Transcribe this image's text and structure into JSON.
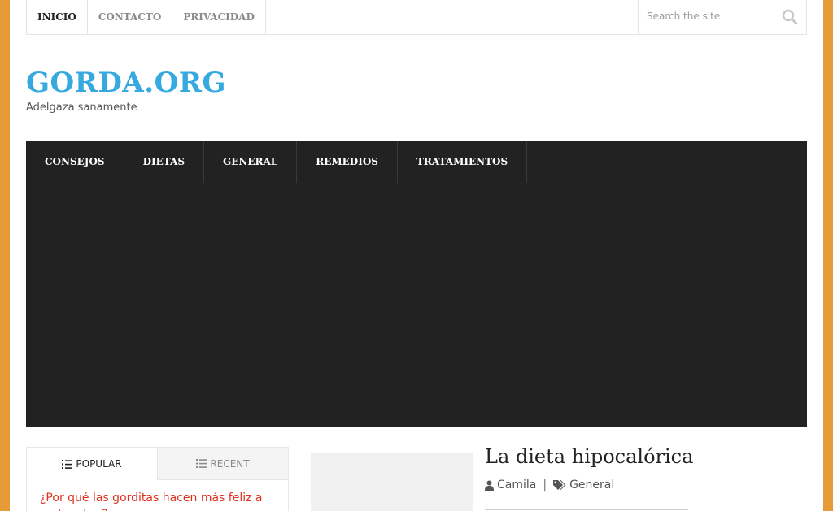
{
  "topnav": {
    "items": [
      {
        "label": "INICIO",
        "active": true
      },
      {
        "label": "CONTACTO",
        "active": false
      },
      {
        "label": "PRIVACIDAD",
        "active": false
      }
    ]
  },
  "search": {
    "placeholder": "Search the site",
    "icon": "search-icon"
  },
  "site": {
    "title": "GORDA.ORG",
    "tagline": "Adelgaza sanamente",
    "title_color": "#36a9e0"
  },
  "mainnav": {
    "items": [
      {
        "label": "CONSEJOS"
      },
      {
        "label": "DIETAS"
      },
      {
        "label": "GENERAL"
      },
      {
        "label": "REMEDIOS"
      },
      {
        "label": "TRATAMIENTOS"
      }
    ]
  },
  "sidebar": {
    "tabs": [
      {
        "label": "POPULAR",
        "active": true,
        "icon": "list-ordered-icon"
      },
      {
        "label": "RECENT",
        "active": false,
        "icon": "list-icon"
      }
    ],
    "first_link": "¿Por qué las gorditas hacen más feliz a un hombre?"
  },
  "post": {
    "title": "La dieta hipocalórica",
    "author": "Camila",
    "category": "General",
    "author_icon": "user-icon",
    "category_icon": "tags-icon"
  },
  "colors": {
    "background": "#e69a38",
    "nav": "#222222",
    "link": "#e0301e"
  }
}
